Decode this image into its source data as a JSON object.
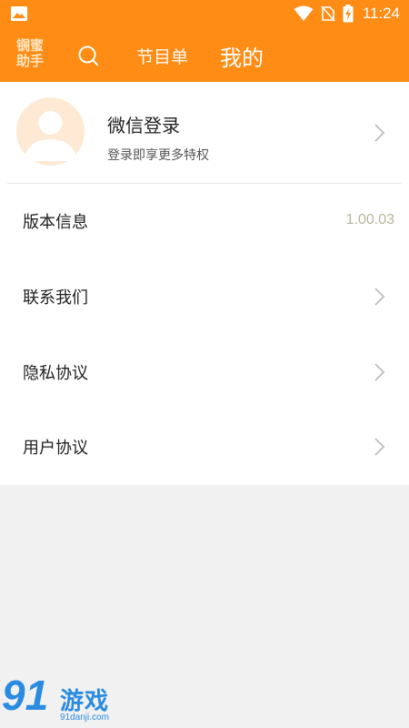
{
  "status_bar": {
    "time": "11:24",
    "icons": [
      "gallery-icon",
      "wifi-icon",
      "no-sim-icon",
      "battery-charging-icon"
    ]
  },
  "app_bar": {
    "logo_line1": "锎蜜",
    "logo_line2": "助手",
    "search_icon": "search-icon",
    "tabs": [
      {
        "label": "节目单",
        "active": false
      },
      {
        "label": "我的",
        "active": true
      }
    ],
    "color": "#ff8c14"
  },
  "profile": {
    "title": "微信登录",
    "subtitle": "登录即享更多特权"
  },
  "menu": [
    {
      "label": "版本信息",
      "value": "1.00.03"
    },
    {
      "label": "联系我们"
    },
    {
      "label": "隐私协议"
    },
    {
      "label": "用户协议"
    }
  ],
  "watermark": {
    "number": "91",
    "text": "游戏",
    "url": "91danji.com"
  }
}
